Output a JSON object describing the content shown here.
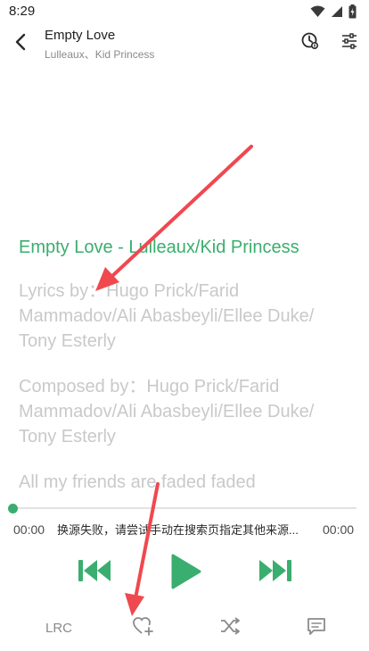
{
  "status_bar": {
    "time": "8:29",
    "icons": [
      "wifi-icon",
      "signal-icon",
      "battery-icon"
    ]
  },
  "header": {
    "back_icon": "back-arrow-icon",
    "title": "Empty Love",
    "artist": "Lulleaux、Kid Princess",
    "timer_icon": "sleep-timer-icon",
    "eq_icon": "equalizer-icon"
  },
  "lyrics": {
    "lines": [
      "Empty Love - Lulleaux/Kid Princess",
      "Lyrics by：Hugo Prick/Farid",
      "Mammadov/Ali Abasbeyli/Ellee Duke/",
      "Tony Esterly",
      "Composed by：Hugo Prick/Farid",
      "Mammadov/Ali Abasbeyli/Ellee Duke/",
      "Tony Esterly",
      "All my friends are faded faded"
    ]
  },
  "player": {
    "current_time": "00:00",
    "total_time": "00:00",
    "status_message": "换源失败，请尝试手动在搜索页指定其他来源...",
    "progress": 0,
    "prev_icon": "skip-previous-icon",
    "play_icon": "play-icon",
    "next_icon": "skip-next-icon"
  },
  "bottom_bar": {
    "lrc_label": "LRC",
    "favorite_icon": "heart-add-icon",
    "shuffle_icon": "shuffle-icon",
    "comment_icon": "comment-icon"
  },
  "colors": {
    "accent": "#3aae6e",
    "lyric_inactive": "#c9c9c9",
    "annotation": "#f0484f"
  }
}
